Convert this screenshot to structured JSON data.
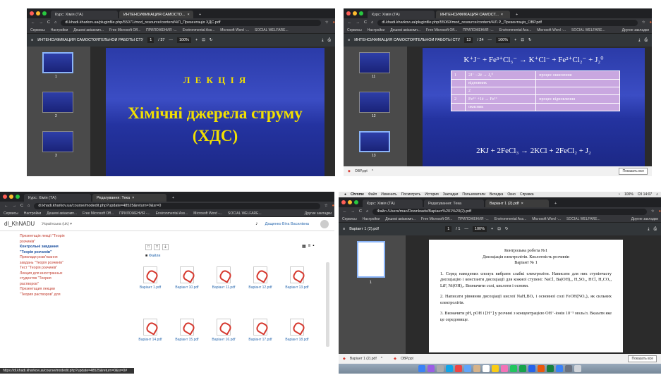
{
  "colors": {
    "slide_blue": "#2b3ba8",
    "title_yellow": "#f2e000",
    "chrome_dark": "#202124",
    "pdf_toolbar": "#323639",
    "table_purple": "#c9a7e0",
    "moodle_link": "#2c6bb0"
  },
  "common": {
    "bookmarks": [
      "Сервисы",
      "Настройки",
      "Дешеві авіакомп...",
      "Free Microsoft Off...",
      "ПРИЛОЖЕНИЯ -...",
      "Environmental Ass...",
      "Microsoft Word -...",
      "SOCIAL WELFARE..."
    ],
    "other_bookmarks": "Другие закладки",
    "show_all": "Показать все"
  },
  "s1": {
    "tabs": [
      "Курс: Хімія (ТА)",
      "ИНТЕНСИФИКАЦИЯ САМОСТО..."
    ],
    "url": "dl.khadi.kharkov.ua/pluginfile.php/55071/mod_resource/content/4/Л_Презентація ХДС.pdf",
    "doc_title": "ИНТЕНСИФИКАЦИЯ САМОСТОЯТЕЛЬНОЙ РАБОТЫ СТУДЕНТОВ В ...",
    "page": "1",
    "pages": "/ 37",
    "zoom": "100%",
    "thumb_nums": [
      "1",
      "2",
      "3"
    ],
    "lecture": "Л Е К Ц І Я",
    "title_l1": "Хімічні джерела струму",
    "title_l2": "(ХДС)"
  },
  "s2": {
    "tabs": [
      "Курс: Хімія (ТА)",
      "ИНТЕНСИФИКАЦИЯ САМОСТ..."
    ],
    "url": "dl.khadi.kharkov.ua/pluginfile.php/55069/mod_resource/content/4/Л.Р._Презентація_ОВР.pdf",
    "doc_title": "ИНТЕНСИФИКАЦИЯ САМОСТОЯТЕЛЬНОЙ РАБОТЫ СТУДЕНТОВ В ...",
    "page": "13",
    "pages": "/ 24",
    "zoom": "100%",
    "thumb_nums": [
      "11",
      "12",
      "13"
    ],
    "eq_top": "K⁺J⁻ + Fe³⁺Cl₃⁻ → K⁺Cl⁻ + Fe²⁺Cl₂⁻ + J₂⁰",
    "rows": [
      [
        "1",
        "2J⁻ −2ē → J₂⁰",
        "процес окиснення"
      ],
      [
        "",
        "відновник",
        ""
      ],
      [
        "",
        "2",
        ""
      ],
      [
        "2",
        "Fe³⁺ +1ē → Fe²⁺",
        "процес відновлення"
      ],
      [
        "",
        "окисник",
        ""
      ]
    ],
    "eq_bottom": "2KJ + 2FeCl₃ → 2KCl + 2FeCl₂ + J₂",
    "download": "ОВР.ppt"
  },
  "s3": {
    "tabs": [
      "Курс: Хімія (ТА)",
      "Редагування: Тека"
    ],
    "url": "dl.khadi.kharkov.ua/course/modedit.php?update=48525&return=0&sr=0",
    "site": "dl_KhNADU",
    "lang": "Українська (uk) ▾",
    "user": "Дащенко Віта Василівна",
    "left": [
      "Презентація лекції \"Теорія розчинів\"",
      "Контрольні завдання \"Теорія розчинів\"",
      "Приклади розв'язання завдань \"Теорія розчинів\"",
      "Тест \"Теорія розчинів\"",
      "Лекция для иностранных студентов \"Теория растворов\"",
      "Презентация лекции \"Теория растворов\" для"
    ],
    "files_label": "Файли",
    "files": [
      "Варіант 1.pdf",
      "Варіант 10.pdf",
      "Варіант 11.pdf",
      "Варіант 12.pdf",
      "Варіант 13.pdf",
      "Варіант 14.pdf",
      "Варіант 15.pdf",
      "Варіант 16.pdf",
      "Варіант 17.pdf",
      "Варіант 18.pdf"
    ],
    "status": "https://dl.khadi.kharkov.ua/course/modedit.php?update=48525&return=0&sr=0#"
  },
  "s4": {
    "menu": [
      "Chrome",
      "Файл",
      "Изменить",
      "Посмотреть",
      "История",
      "Закладки",
      "Пользователи",
      "Вкладка",
      "Окно",
      "Справка"
    ],
    "clock": "Сб 14:07",
    "battery": "100%",
    "tabs": [
      "Курс: Хімія (ТА)",
      "Редагування: Тека",
      "Варіант 1 (2).pdf"
    ],
    "url": "Файл  /Users/mac/Downloads/Варіант%201%20(2).pdf",
    "doc_title": "Варіант 1 (2).pdf",
    "page": "1",
    "pages": "/ 1",
    "zoom": "100%",
    "thumb_num": "1",
    "h1": "Контрольна робота №1",
    "h2": "Дисоціація електролітів. Кислотність розчинів",
    "h3": "Варіант № 1",
    "p1": "1. Серед наведених сполук вибрати слабкі електроліти. Написати для них ступінчасту дисоціацію і константи дисоціації для кожної ступені: NaCl, Ba(OH)₂, H₂SO₄, HCl, H₂CO₃, LiF, Ni(OH)₂. Визначити солі, кислоти і основи.",
    "p2": "2. Написати рівняння дисоціації кислої NaH₂BO₃ і основної солі FeOH(NO₃)₂ як сильних електролітів.",
    "p3": "3. Визначити pH, pOH і [H⁺] у розчині з концентрацією OH⁻-іонів 10⁻⁵ моль/л. Вказати яке це середовище.",
    "downloads": [
      "Варіант 1 (2).pdf",
      "ОВР.ppt"
    ]
  }
}
